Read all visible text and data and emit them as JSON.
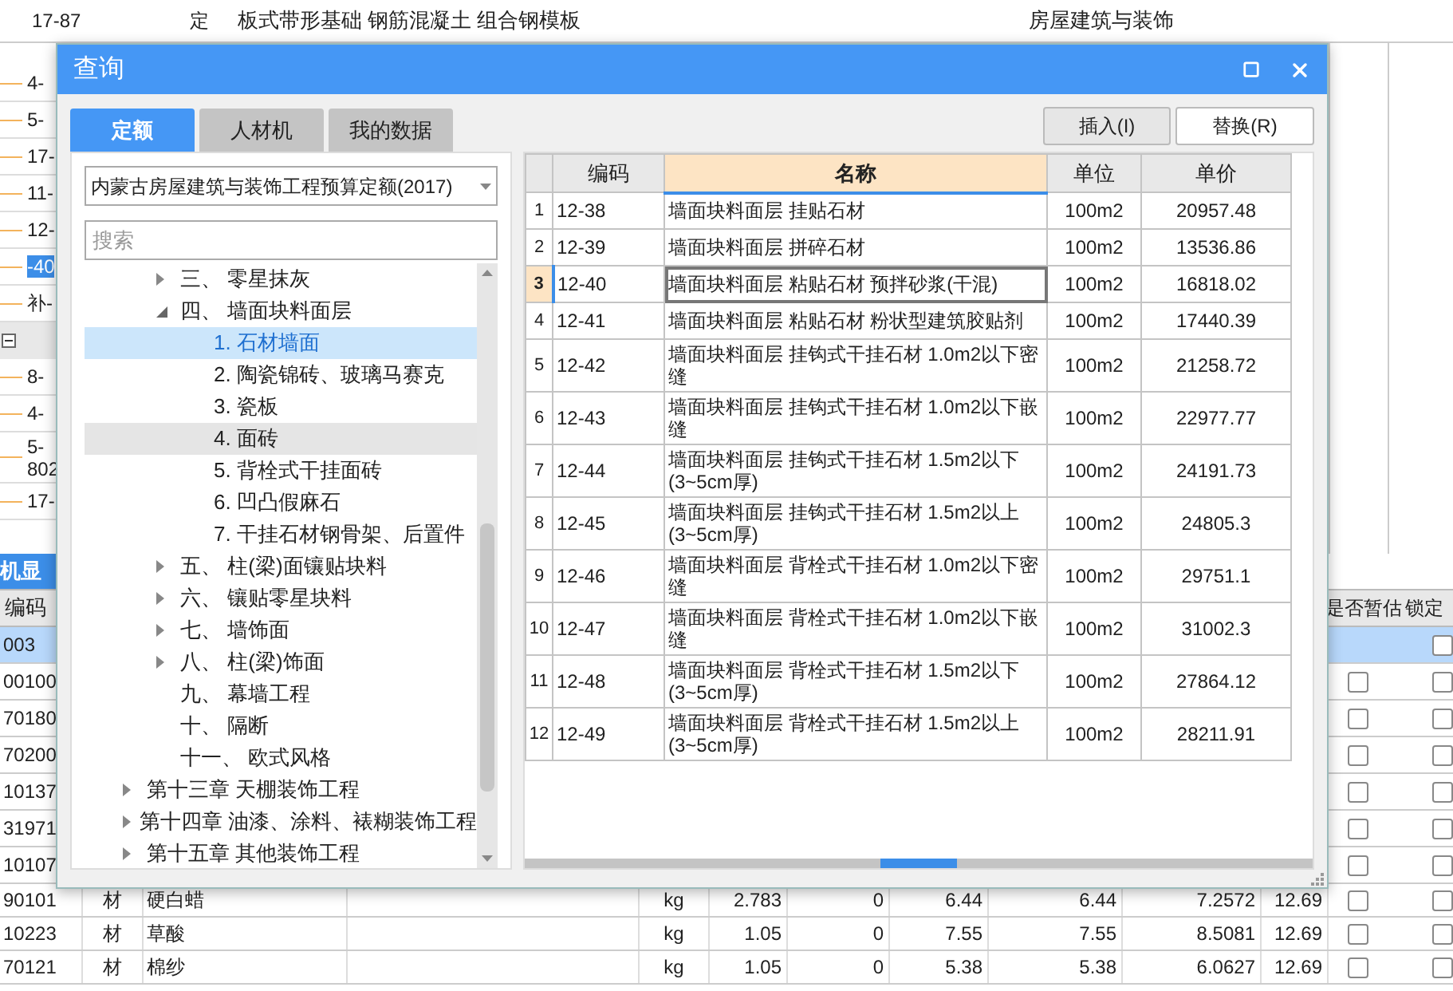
{
  "background": {
    "top_row": {
      "code": "17-87",
      "type": "定",
      "name": "板式带形基础 钢筋混凝土 组合钢模板",
      "source": "房屋建筑与装饰"
    },
    "upper_codes": [
      {
        "kind": "code",
        "lines": [
          "4-"
        ],
        "selected": false
      },
      {
        "kind": "code",
        "lines": [
          "5-"
        ],
        "selected": false
      },
      {
        "kind": "code",
        "lines": [
          "17-"
        ],
        "selected": false
      },
      {
        "kind": "code",
        "lines": [
          "11-"
        ],
        "selected": false
      },
      {
        "kind": "code",
        "lines": [
          "12-"
        ],
        "selected": false
      },
      {
        "kind": "code",
        "lines": [
          "-40"
        ],
        "selected": true
      },
      {
        "kind": "code",
        "lines": [
          "补-"
        ],
        "selected": false
      },
      {
        "kind": "group"
      },
      {
        "kind": "code",
        "lines": [
          "8-"
        ],
        "selected": false
      },
      {
        "kind": "code",
        "lines": [
          "4-"
        ],
        "selected": false
      },
      {
        "kind": "code",
        "lines": [
          "5-",
          "802"
        ],
        "selected": false
      },
      {
        "kind": "code",
        "lines": [
          "17-"
        ],
        "selected": false
      }
    ],
    "section_title": "机显",
    "lower_header": {
      "code": "编码",
      "estimated": "是否暂估",
      "locked": "锁定"
    },
    "lower_rows": [
      {
        "code": "003",
        "selected": true,
        "locked": false
      },
      {
        "code": "00100",
        "selected": false,
        "estimated": false,
        "locked": false
      },
      {
        "code": "70180",
        "selected": false,
        "estimated": false,
        "locked": false
      },
      {
        "code": "70200",
        "selected": false,
        "estimated": false,
        "locked": false
      },
      {
        "code": "10137",
        "selected": false,
        "estimated": false,
        "locked": false
      },
      {
        "code": "31971",
        "selected": false,
        "estimated": false,
        "locked": false
      },
      {
        "code": "10107",
        "selected": false,
        "estimated": false,
        "locked": false
      },
      {
        "code": "90101",
        "selected": false,
        "type": "材",
        "name": "硬白蜡",
        "unit": "kg",
        "qty": "2.783",
        "column_6": "0",
        "column_7": "6.44",
        "column_8": "6.44",
        "column_9": "7.2572",
        "column_10": "12.69",
        "estimated": false,
        "locked": false
      },
      {
        "code": "10223",
        "selected": false,
        "type": "材",
        "name": "草酸",
        "unit": "kg",
        "qty": "1.05",
        "column_6": "0",
        "column_7": "7.55",
        "column_8": "7.55",
        "column_9": "8.5081",
        "column_10": "12.69",
        "estimated": false,
        "locked": false
      },
      {
        "code": "70121",
        "selected": false,
        "type": "材",
        "name": "棉纱",
        "unit": "kg",
        "qty": "1.05",
        "column_6": "0",
        "column_7": "5.38",
        "column_8": "5.38",
        "column_9": "6.0627",
        "column_10": "12.69",
        "estimated": false,
        "locked": false
      }
    ]
  },
  "dialog": {
    "title": "查询",
    "tabs": [
      {
        "label": "定额",
        "selected": true
      },
      {
        "label": "人材机",
        "selected": false
      },
      {
        "label": "我的数据",
        "selected": false
      }
    ],
    "buttons": [
      "插入(I)",
      "替换(R)"
    ],
    "library": "内蒙古房屋建筑与装饰工程预算定额(2017)",
    "search": {
      "placeholder": "搜索"
    },
    "tree": [
      {
        "children": [
          {
            "label": "三、 零星抹灰",
            "expanded": false,
            "selected": false,
            "highlighted": false
          },
          {
            "label": "四、 墙面块料面层",
            "expanded": true,
            "selected": false,
            "highlighted": false,
            "children": [
              {
                "label": "1. 石材墙面",
                "selected": true,
                "highlighted": false
              },
              {
                "label": "2. 陶瓷锦砖、玻璃马赛克",
                "selected": false,
                "highlighted": false
              },
              {
                "label": "3. 瓷板",
                "selected": false,
                "highlighted": false
              },
              {
                "label": "4. 面砖",
                "selected": false,
                "highlighted": true
              },
              {
                "label": "5. 背栓式干挂面砖",
                "selected": false,
                "highlighted": false
              },
              {
                "label": "6. 凹凸假麻石",
                "selected": false,
                "highlighted": false
              },
              {
                "label": "7. 干挂石材钢骨架、后置件",
                "selected": false,
                "highlighted": false
              }
            ]
          },
          {
            "label": "五、 柱(梁)面镶贴块料",
            "expanded": false,
            "selected": false,
            "highlighted": false
          },
          {
            "label": "六、 镶贴零星块料",
            "expanded": false,
            "selected": false,
            "highlighted": false
          },
          {
            "label": "七、 墙饰面",
            "expanded": false,
            "selected": false,
            "highlighted": false
          },
          {
            "label": "八、 柱(梁)饰面",
            "expanded": false,
            "selected": false,
            "highlighted": false
          },
          {
            "label": "九、 幕墙工程",
            "selected": false,
            "highlighted": false
          },
          {
            "label": "十、 隔断",
            "selected": false,
            "highlighted": false
          },
          {
            "label": "十一、 欧式风格",
            "selected": false,
            "highlighted": false
          }
        ]
      },
      {
        "label": "第十三章 天棚装饰工程",
        "expanded": false,
        "selected": false,
        "highlighted": false
      },
      {
        "label": "第十四章 油漆、涂料、裱糊装饰工程",
        "expanded": false,
        "selected": false,
        "highlighted": false
      },
      {
        "label": "第十五章 其他装饰工程",
        "expanded": false,
        "selected": false,
        "highlighted": false
      }
    ],
    "table": {
      "columns": [
        {
          "label": "编码",
          "selected": false
        },
        {
          "label": "名称",
          "selected": true
        },
        {
          "label": "单位",
          "selected": false
        },
        {
          "label": "单价",
          "selected": false
        }
      ],
      "rows": [
        {
          "index": "1",
          "code": "12-38",
          "name": "墙面块料面层 挂贴石材",
          "unit": "100m2",
          "price": "20957.48",
          "selected": false
        },
        {
          "index": "2",
          "code": "12-39",
          "name": "墙面块料面层 拼碎石材",
          "unit": "100m2",
          "price": "13536.86",
          "selected": false
        },
        {
          "index": "3",
          "code": "12-40",
          "name": "墙面块料面层 粘贴石材 预拌砂浆(干混)",
          "unit": "100m2",
          "price": "16818.02",
          "selected": true
        },
        {
          "index": "4",
          "code": "12-41",
          "name": "墙面块料面层 粘贴石材 粉状型建筑胶贴剂",
          "unit": "100m2",
          "price": "17440.39",
          "selected": false
        },
        {
          "index": "5",
          "code": "12-42",
          "name": "墙面块料面层 挂钩式干挂石材 1.0m2以下密缝",
          "unit": "100m2",
          "price": "21258.72",
          "selected": false
        },
        {
          "index": "6",
          "code": "12-43",
          "name": "墙面块料面层 挂钩式干挂石材 1.0m2以下嵌缝",
          "unit": "100m2",
          "price": "22977.77",
          "selected": false
        },
        {
          "index": "7",
          "code": "12-44",
          "name": "墙面块料面层 挂钩式干挂石材 1.5m2以下(3~5cm厚)",
          "unit": "100m2",
          "price": "24191.73",
          "selected": false
        },
        {
          "index": "8",
          "code": "12-45",
          "name": "墙面块料面层 挂钩式干挂石材 1.5m2以上(3~5cm厚)",
          "unit": "100m2",
          "price": "24805.3",
          "selected": false
        },
        {
          "index": "9",
          "code": "12-46",
          "name": "墙面块料面层 背栓式干挂石材 1.0m2以下密缝",
          "unit": "100m2",
          "price": "29751.1",
          "selected": false
        },
        {
          "index": "10",
          "code": "12-47",
          "name": "墙面块料面层 背栓式干挂石材 1.0m2以下嵌缝",
          "unit": "100m2",
          "price": "31002.3",
          "selected": false
        },
        {
          "index": "11",
          "code": "12-48",
          "name": "墙面块料面层 背栓式干挂石材 1.5m2以下(3~5cm厚)",
          "unit": "100m2",
          "price": "27864.12",
          "selected": false
        },
        {
          "index": "12",
          "code": "12-49",
          "name": "墙面块料面层 背栓式干挂石材 1.5m2以上(3~5cm厚)",
          "unit": "100m2",
          "price": "28211.91",
          "selected": false
        }
      ]
    }
  }
}
